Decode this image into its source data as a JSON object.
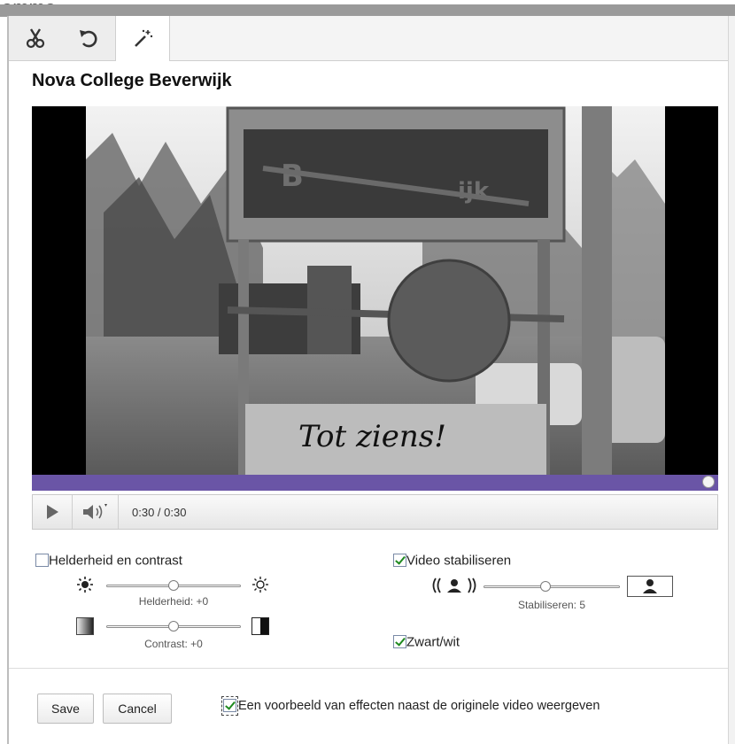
{
  "background": {
    "text": "amma"
  },
  "toolbar": {
    "tabs": [
      {
        "icon": "scissors-icon"
      },
      {
        "icon": "undo-icon"
      },
      {
        "icon": "magic-wand-icon"
      }
    ],
    "active_tab": 2
  },
  "video": {
    "title": "Nova College Beverwijk",
    "sign_text": "Tot ziens!",
    "time_display": "0:30 / 0:30",
    "progress": 1.0,
    "progress_color": "#6a55a6"
  },
  "effects": {
    "brightness_contrast": {
      "label": "Helderheid en contrast",
      "checked": false,
      "brightness_caption": "Helderheid: +0",
      "brightness_value": 0,
      "contrast_caption": "Contrast: +0",
      "contrast_value": 0
    },
    "stabilize": {
      "label": "Video stabiliseren",
      "checked": true,
      "caption": "Stabiliseren: 5",
      "value": 5
    },
    "bw": {
      "label": "Zwart/wit",
      "checked": true
    }
  },
  "footer": {
    "save_label": "Save",
    "cancel_label": "Cancel",
    "preview_label": "Een voorbeeld van effecten naast de originele video weergeven",
    "preview_checked": true
  },
  "colors": {
    "check": "#1f8a1f",
    "checkbox_border": "#7a8aa6"
  }
}
